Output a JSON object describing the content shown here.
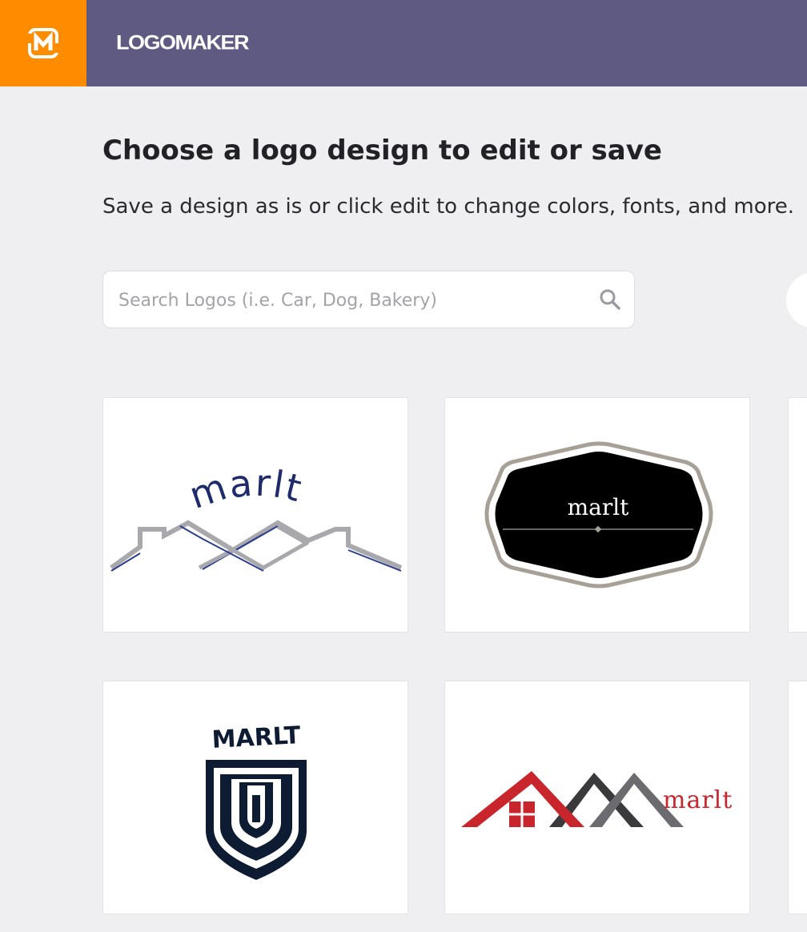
{
  "header": {
    "brand_name": "LOGOMAKER",
    "app_icon": "logomaker-m-icon",
    "accent_color": "#ff8c00",
    "bar_color": "#5e5a81"
  },
  "page": {
    "title": "Choose a logo design to edit or save",
    "subtitle": "Save a design as is or click edit to change colors, fonts, and more."
  },
  "search": {
    "placeholder": "Search Logos (i.e. Car, Dog, Bakery)",
    "value": "",
    "icon": "search-icon"
  },
  "logos": [
    {
      "text": "marlt",
      "style": "rooftops-blue-gray",
      "text_color": "#1f2a6b"
    },
    {
      "text": "marlt",
      "style": "black-hexagon-badge",
      "text_color": "#ffffff"
    },
    {
      "text": "MARLT",
      "style": "navy-shield-crest",
      "text_color": "#0d1b33"
    },
    {
      "text": "marlt",
      "style": "red-gray-rooftops",
      "text_color": "#c8262c"
    }
  ]
}
